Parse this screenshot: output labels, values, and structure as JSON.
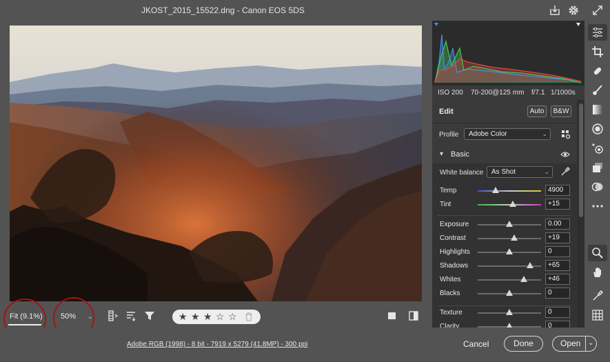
{
  "window": {
    "title": "JKOST_2015_15522.dng  -  Canon EOS 5DS"
  },
  "top_icons": [
    "save-icon",
    "gear-icon",
    "fullscreen-icon"
  ],
  "exif": {
    "iso": "ISO 200",
    "lens": "70-200@125 mm",
    "aperture": "f/7.1",
    "shutter": "1/1000s"
  },
  "edit": {
    "title": "Edit",
    "auto_label": "Auto",
    "bw_label": "B&W",
    "profile_label": "Profile",
    "profile_value": "Adobe Color",
    "section_basic": "Basic",
    "white_balance_label": "White balance",
    "white_balance_value": "As Shot"
  },
  "sliders": [
    {
      "name": "Temp",
      "value": "4900",
      "pos": 0.28,
      "track": "temp"
    },
    {
      "name": "Tint",
      "value": "+15",
      "pos": 0.55,
      "track": "tint"
    },
    {
      "name": "Exposure",
      "value": "0.00",
      "pos": 0.5,
      "track": "plain"
    },
    {
      "name": "Contrast",
      "value": "+19",
      "pos": 0.58,
      "track": "plain"
    },
    {
      "name": "Highlights",
      "value": "0",
      "pos": 0.5,
      "track": "plain"
    },
    {
      "name": "Shadows",
      "value": "+65",
      "pos": 0.83,
      "track": "plain"
    },
    {
      "name": "Whites",
      "value": "+46",
      "pos": 0.73,
      "track": "plain"
    },
    {
      "name": "Blacks",
      "value": "0",
      "pos": 0.5,
      "track": "plain"
    },
    {
      "name": "Texture",
      "value": "0",
      "pos": 0.5,
      "track": "plain"
    },
    {
      "name": "Clarity",
      "value": "0",
      "pos": 0.5,
      "track": "plain"
    }
  ],
  "bottom": {
    "fit_label": "Fit (9.1%)",
    "zoom_label": "50%",
    "rating_stars": 3,
    "rating_max": 5
  },
  "footer": {
    "info": "Adobe RGB (1998) - 8 bit - 7919 x 5279 (41.8MP) - 300 ppi",
    "cancel_label": "Cancel",
    "done_label": "Done",
    "open_label": "Open"
  },
  "right_tools": [
    "edit-sliders-icon",
    "crop-icon",
    "healing-icon",
    "brush-icon",
    "linear-gradient-icon",
    "radial-gradient-icon",
    "red-eye-icon",
    "snapshots-icon",
    "presets-icon",
    "more-icon",
    "zoom-icon",
    "hand-icon",
    "color-sampler-icon",
    "grid-icon"
  ],
  "colors": {
    "background": "#535353",
    "panel": "#323232",
    "annotation_circle": "#a31515"
  }
}
